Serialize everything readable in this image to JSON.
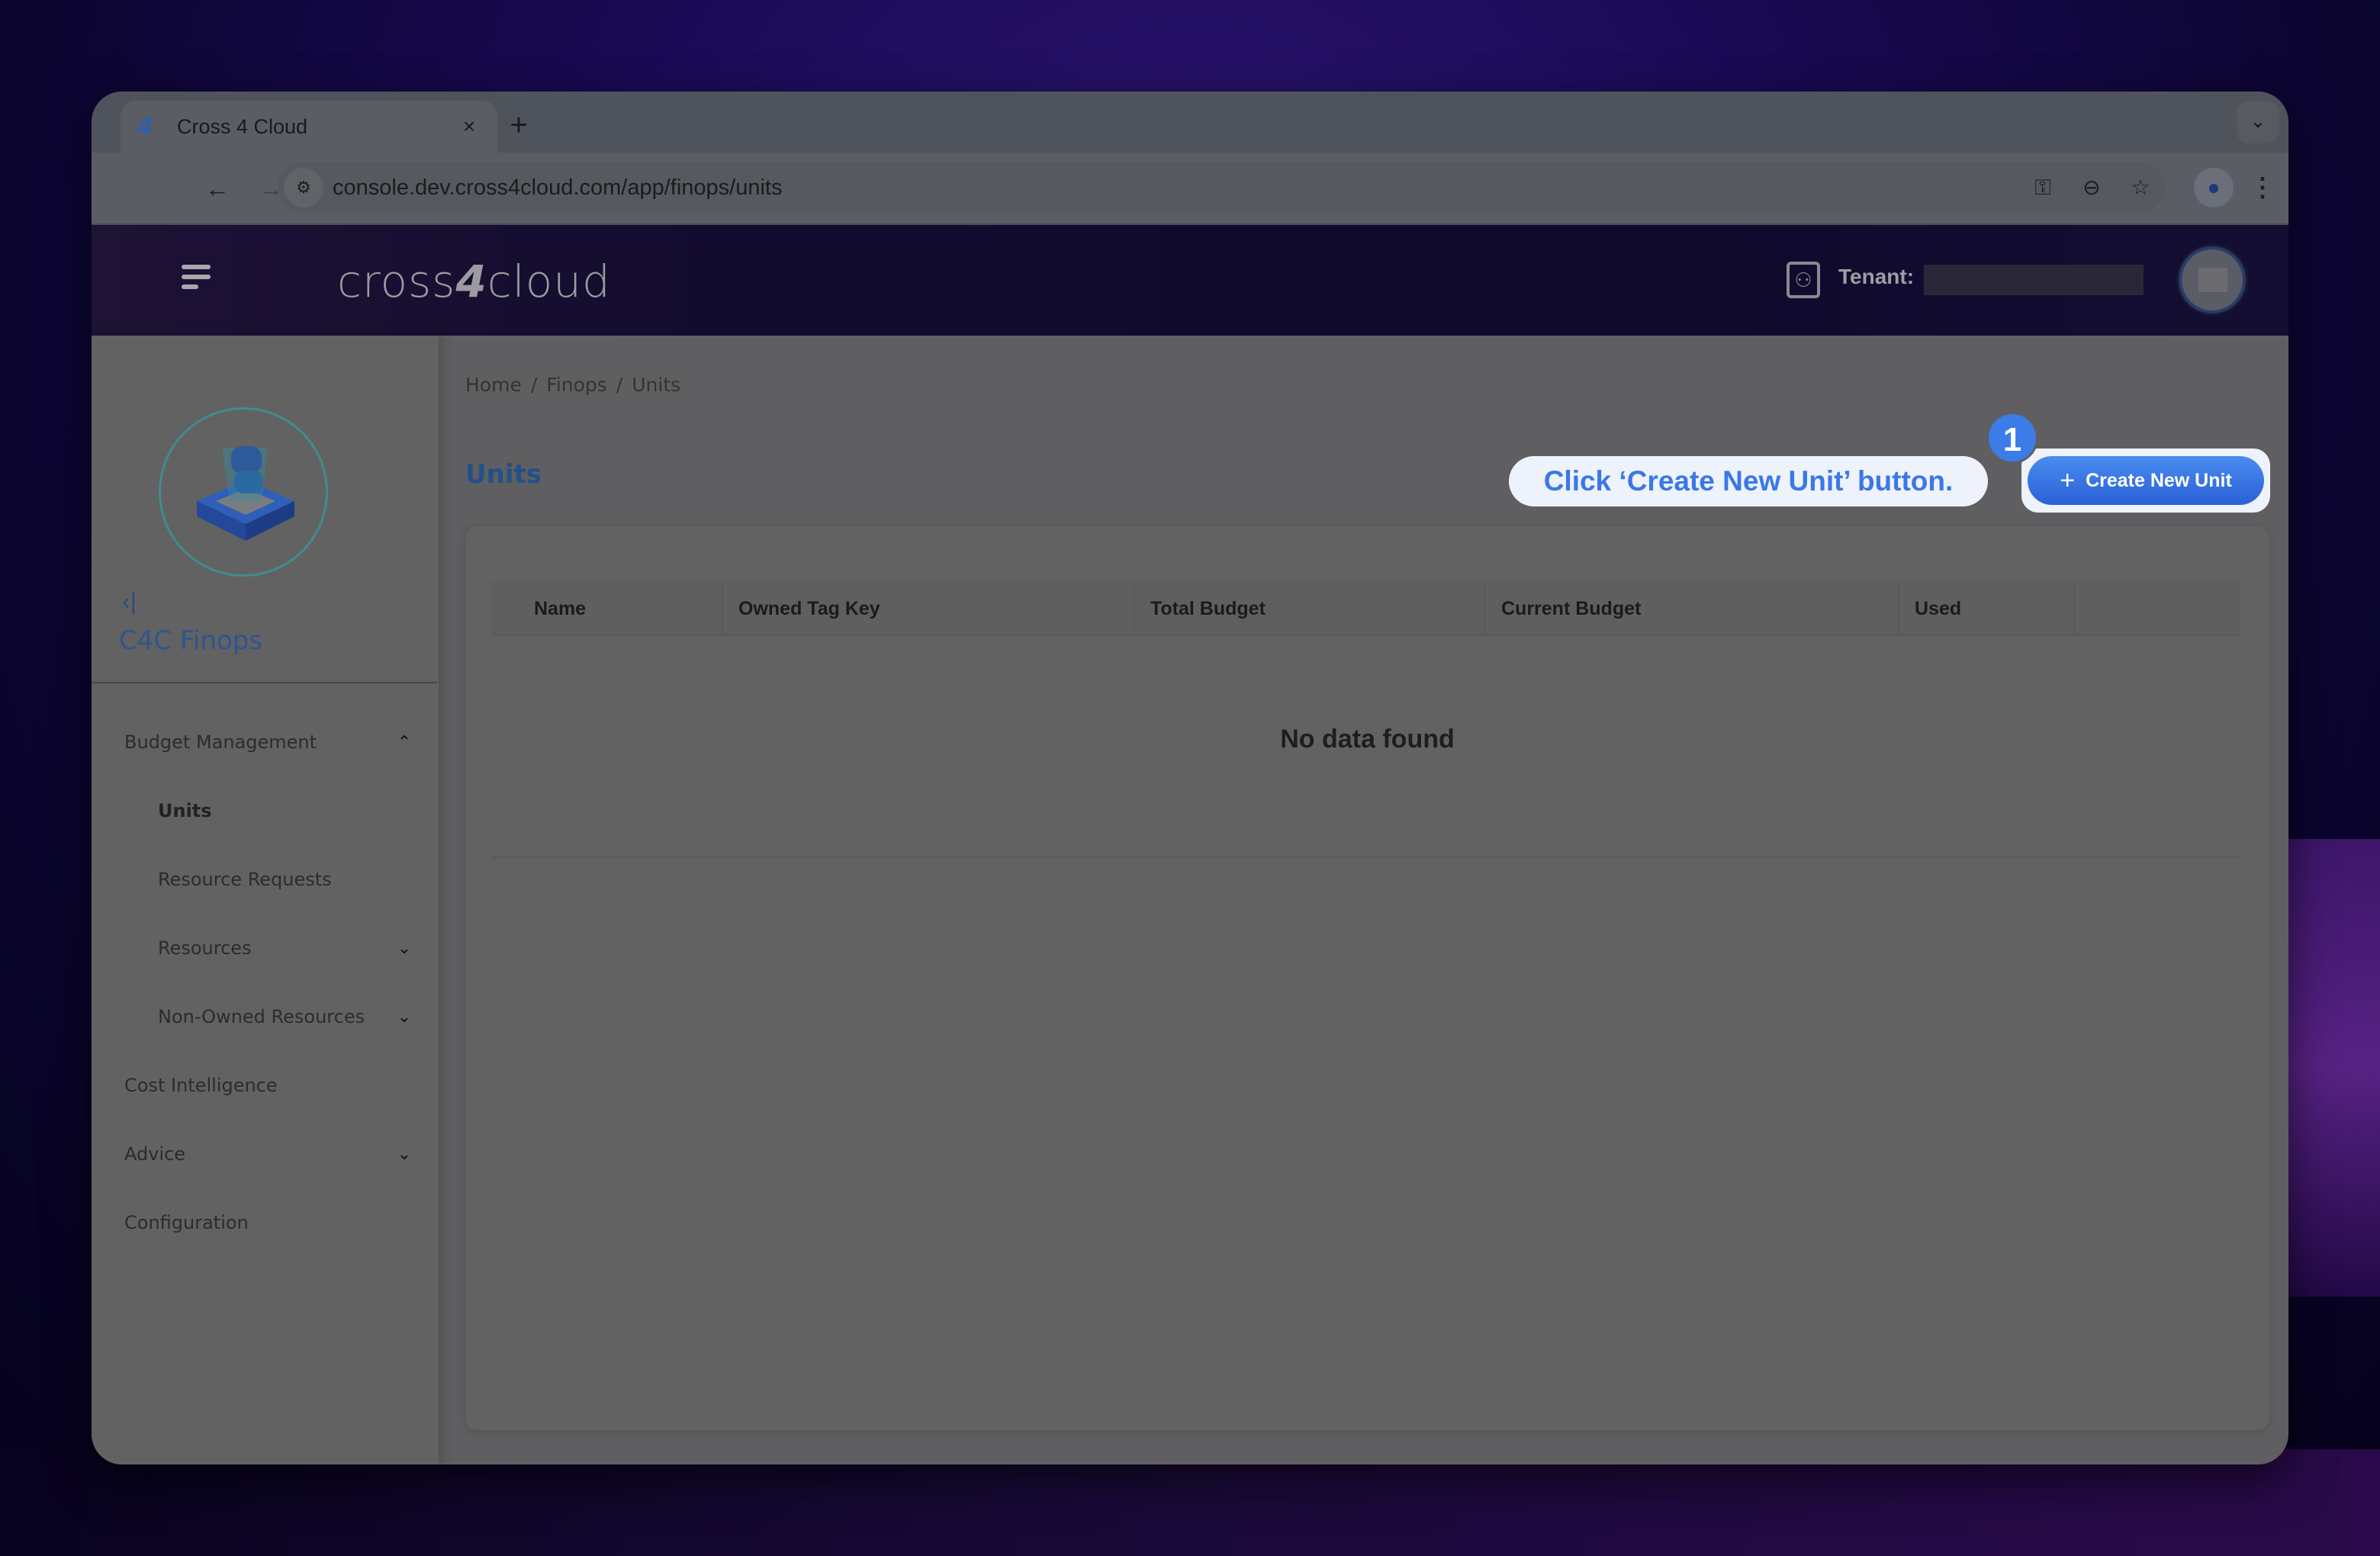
{
  "browser": {
    "tab_title": "Cross 4 Cloud",
    "tab_favicon": "4",
    "tab_close": "×",
    "new_tab": "+",
    "tab_list": "⌄",
    "url": "console.dev.cross4cloud.com/app/finops/units",
    "icons": {
      "back": "←",
      "forward": "→",
      "reload": "↻",
      "site_info": "⚙",
      "password_key": "⚿",
      "zoom": "⊖",
      "bookmark": "☆",
      "profile": "●",
      "menu": "⋮"
    }
  },
  "header": {
    "brand_prefix": "cross",
    "brand_num": "4",
    "brand_suffix": "cloud",
    "tenant_label": "Tenant:",
    "tenant_icon": "⚇"
  },
  "sidebar": {
    "collapse_icon": "‹|",
    "module_title": "C4C Finops",
    "items": [
      {
        "label": "Budget Management",
        "chevron": "⌃",
        "level": 1
      },
      {
        "label": "Units",
        "chevron": "",
        "level": 2,
        "active": true
      },
      {
        "label": "Resource Requests",
        "chevron": "",
        "level": 2
      },
      {
        "label": "Resources",
        "chevron": "⌄",
        "level": 2
      },
      {
        "label": "Non-Owned Resources",
        "chevron": "⌄",
        "level": 2
      },
      {
        "label": "Cost Intelligence",
        "chevron": "",
        "level": 1
      },
      {
        "label": "Advice",
        "chevron": "⌄",
        "level": 1
      },
      {
        "label": "Configuration",
        "chevron": "",
        "level": 1
      }
    ]
  },
  "main": {
    "breadcrumb": [
      "Home",
      "Finops",
      "Units"
    ],
    "breadcrumb_sep": "/",
    "page_title": "Units",
    "create_button_plus": "+",
    "create_button_label": "Create New Unit",
    "table": {
      "columns": [
        "Name",
        "Owned Tag Key",
        "Total Budget",
        "Current Budget",
        "Used",
        ""
      ],
      "empty_message": "No data found"
    }
  },
  "guide": {
    "step_number": "1",
    "hint_text": "Click ‘Create New Unit’ button.",
    "accent_color": "#3b7ce8"
  }
}
